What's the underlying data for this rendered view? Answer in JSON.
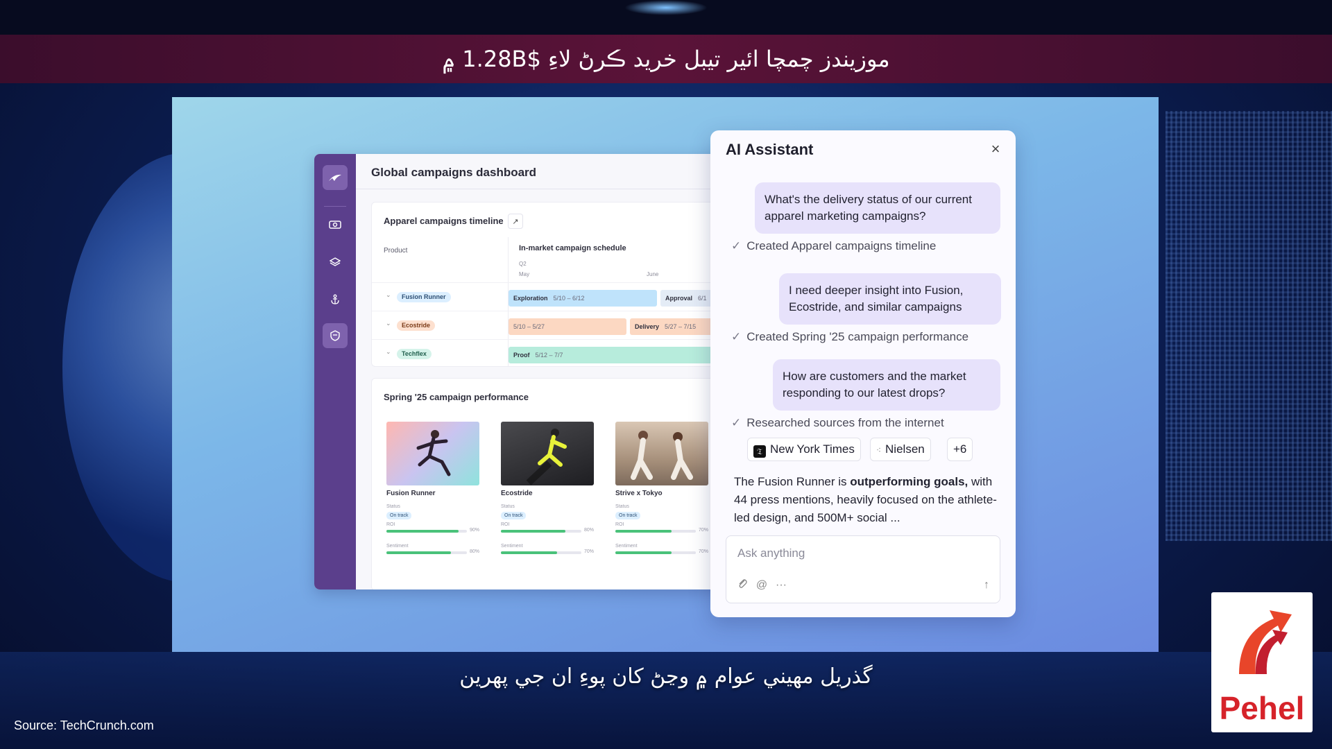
{
  "banner": {
    "text": "موزيندز چمچا ائير تيبل خريد ڪرڻ لاءِ $1.28B ۾"
  },
  "subtitle": {
    "text": "گذريل مهيني عوام ۾ وڃڻ کان پوءِ ان جي پهرين"
  },
  "source": {
    "text": "Source: TechCrunch.com"
  },
  "logo": {
    "text": "Pehel"
  },
  "dashboard": {
    "title": "Global campaigns dashboard",
    "sidebar_icons": [
      "logo-icon",
      "eye-icon",
      "layers-icon",
      "anchor-icon",
      "shield-icon"
    ],
    "timeline": {
      "title": "Apparel campaigns timeline",
      "product_label": "Product",
      "schedule_label": "In-market campaign schedule",
      "quarter_label": "Q2",
      "month_may": "May",
      "month_june": "June",
      "rows": [
        {
          "product": "Fusion Runner",
          "bar1_label": "Exploration",
          "bar1_dates": "5/10 – 6/12",
          "bar2_label": "Approval",
          "bar2_dates": "6/1"
        },
        {
          "product": "Ecostride",
          "bar1_label": "",
          "bar1_dates": "5/10 – 5/27",
          "bar2_label": "Delivery",
          "bar2_dates": "5/27 – 7/15"
        },
        {
          "product": "Techflex",
          "bar1_label": "Proof",
          "bar1_dates": "5/12 – 7/7"
        }
      ]
    },
    "performance": {
      "title": "Spring '25 campaign performance",
      "status_label": "Status",
      "roi_label": "ROI",
      "sentiment_label": "Sentiment",
      "status_value": "On track",
      "products": [
        {
          "name": "Fusion Runner",
          "roi": 90,
          "roi_text": "90%",
          "sentiment": 80,
          "sentiment_text": "80%"
        },
        {
          "name": "Ecostride",
          "roi": 80,
          "roi_text": "80%",
          "sentiment": 70,
          "sentiment_text": "70%"
        },
        {
          "name": "Strive x Tokyo",
          "roi": 70,
          "roi_text": "70%",
          "sentiment": 70,
          "sentiment_text": "70%"
        }
      ]
    }
  },
  "assistant": {
    "title": "AI Assistant",
    "close_icon": "×",
    "messages": [
      "What's the delivery status of our current apparel marketing campaigns?",
      "I need deeper insight into Fusion, Ecostride, and similar campaigns",
      "How are customers and the market responding to our latest drops?"
    ],
    "notes": [
      "Created Apparel campaigns timeline",
      "Created Spring '25 campaign performance",
      "Researched sources from the internet"
    ],
    "sources": {
      "nyt": "New York Times",
      "nielsen": "Nielsen",
      "more": "+6"
    },
    "answer": {
      "pre": "The Fusion Runner is ",
      "bold": "outperforming goals,",
      "post": " with 44 press mentions, heavily focused on the athlete-led design, and 500M+ social ..."
    },
    "input_placeholder": "Ask anything"
  }
}
